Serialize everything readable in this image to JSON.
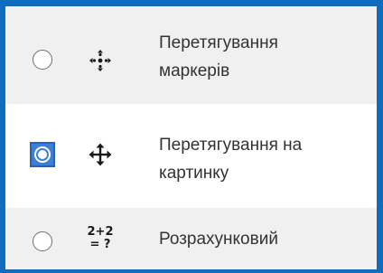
{
  "options": [
    {
      "label_line1": "Перетягування",
      "label_line2": "маркерів",
      "icon": "drag-markers-icon",
      "selected": false
    },
    {
      "label_line1": "Перетягування на",
      "label_line2": "картинку",
      "icon": "move-arrows-icon",
      "selected": true
    },
    {
      "label_line1": "Розрахунковий",
      "icon": "calculation-icon",
      "icon_top": "2+2",
      "icon_bottom": "= ?",
      "selected": false
    }
  ],
  "colors": {
    "accent": "#0f6cbf",
    "selected_radio": "#3d7fd6",
    "row_alt": "#f0f0f0",
    "text": "#333333"
  }
}
